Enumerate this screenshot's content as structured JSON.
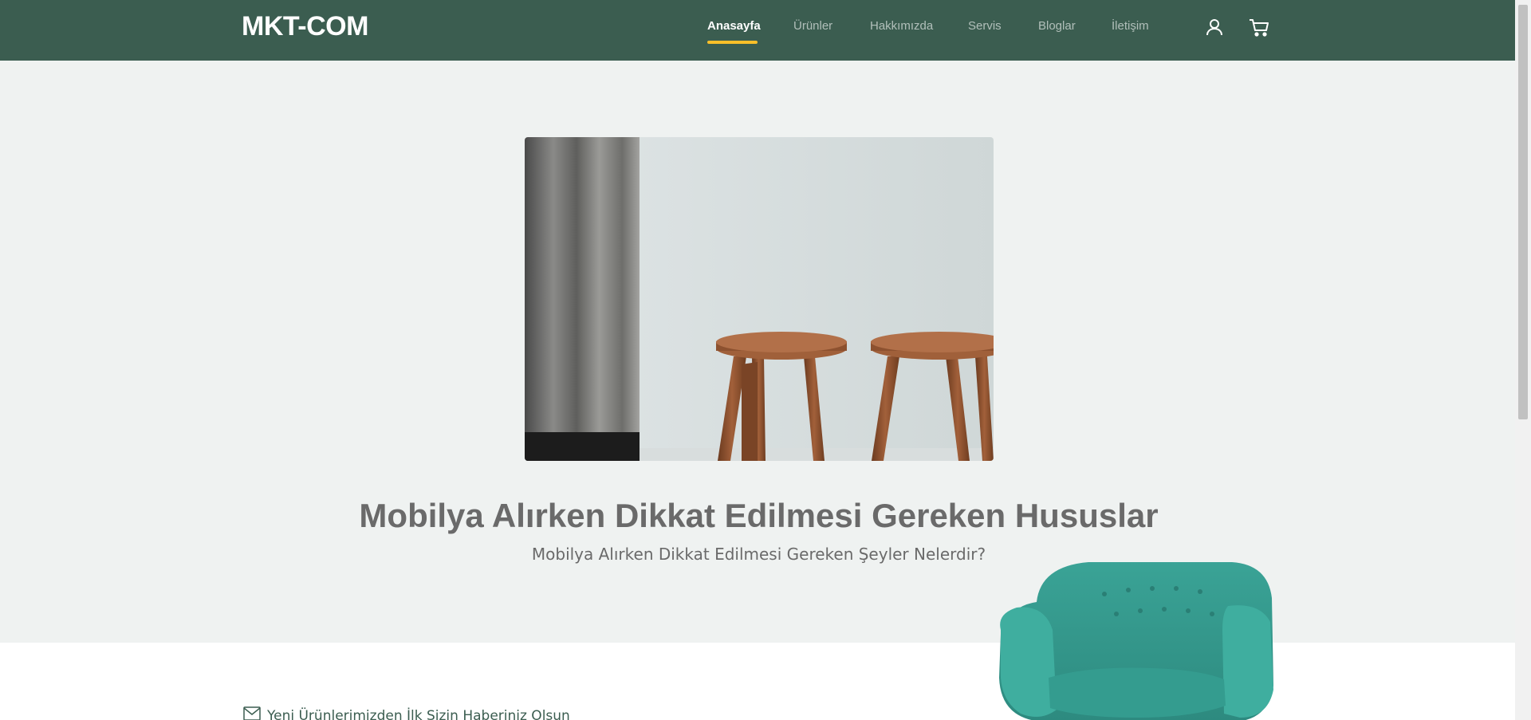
{
  "brand": "MKT-COM",
  "nav": {
    "items": [
      {
        "label": "Anasayfa",
        "active": true
      },
      {
        "label": "Ürünler",
        "active": false
      },
      {
        "label": "Hakkımızda",
        "active": false
      },
      {
        "label": "Servis",
        "active": false
      },
      {
        "label": "Bloglar",
        "active": false
      },
      {
        "label": "İletişim",
        "active": false
      }
    ],
    "icons": [
      "user-icon",
      "cart-icon"
    ]
  },
  "hero": {
    "title": "Mobilya Alırken Dikkat Edilmesi Gereken Hususlar",
    "subtitle": "Mobilya Alırken Dikkat Edilmesi Gereken Şeyler Nelerdir?"
  },
  "newsletter": {
    "text": "Yeni Ürünlerimizden İlk Sizin Haberiniz Olsun",
    "icon": "envelope-icon"
  },
  "colors": {
    "navbar": "#3b5d50",
    "accent": "#f9bf29",
    "hero_bg": "#eff2f1",
    "sofa": "#3a9e93"
  }
}
